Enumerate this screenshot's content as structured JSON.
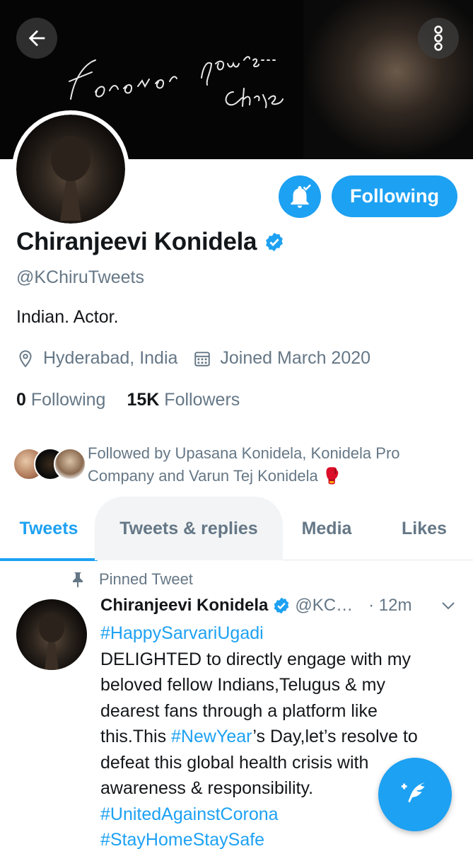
{
  "banner": {
    "script_text": "Forever yours...",
    "signature": "Chiru"
  },
  "profile": {
    "name": "Chiranjeevi Konidela",
    "handle": "@KChiruTweets",
    "bio": "Indian. Actor.",
    "location": "Hyderabad, India",
    "joined": "Joined March 2020",
    "following_count": "0",
    "following_label": "Following",
    "followers_count": "15K",
    "followers_label": "Followers",
    "follow_button_label": "Following",
    "followed_by_text": "Followed by Upasana Konidela, Konidela Pro Company and Varun Tej Konidela",
    "followed_by_emoji": "🥊"
  },
  "tabs": [
    {
      "label": "Tweets",
      "active": true
    },
    {
      "label": "Tweets & replies",
      "active": false
    },
    {
      "label": "Media",
      "active": false
    },
    {
      "label": "Likes",
      "active": false
    }
  ],
  "tweet": {
    "pinned_label": "Pinned Tweet",
    "author_name": "Chiranjeevi Konidela",
    "author_handle": "@KC…",
    "time": "· 12m",
    "lines": [
      {
        "text": "",
        "tag": "#HappySarvariUgadi",
        "after": ""
      },
      {
        "text": "DELIGHTED to directly engage with my",
        "tag": "",
        "after": ""
      },
      {
        "text": "beloved fellow Indians,Telugus & my",
        "tag": "",
        "after": ""
      },
      {
        "text": "dearest fans through a platform like",
        "tag": "",
        "after": ""
      },
      {
        "text": "this.This ",
        "tag": "#NewYear",
        "after": "’s Day,let’s resolve to"
      },
      {
        "text": "defeat this global health crisis with",
        "tag": "",
        "after": ""
      },
      {
        "text": "awareness & responsibility.",
        "tag": "",
        "after": ""
      },
      {
        "text": "",
        "tag": "#UnitedAgainstCorona",
        "after": ""
      },
      {
        "text": "",
        "tag": "#StayHomeStaySafe",
        "after": ""
      }
    ]
  },
  "colors": {
    "accent": "#1da1f2",
    "muted": "#657786",
    "text": "#14171a"
  },
  "icons": {
    "back": "arrow-left-icon",
    "more": "more-vertical-icon",
    "bell": "bell-check-icon",
    "verified": "verified-badge-icon",
    "location": "location-pin-icon",
    "calendar": "calendar-icon",
    "pin": "pin-icon",
    "caret": "chevron-down-icon",
    "compose": "compose-feather-icon"
  }
}
